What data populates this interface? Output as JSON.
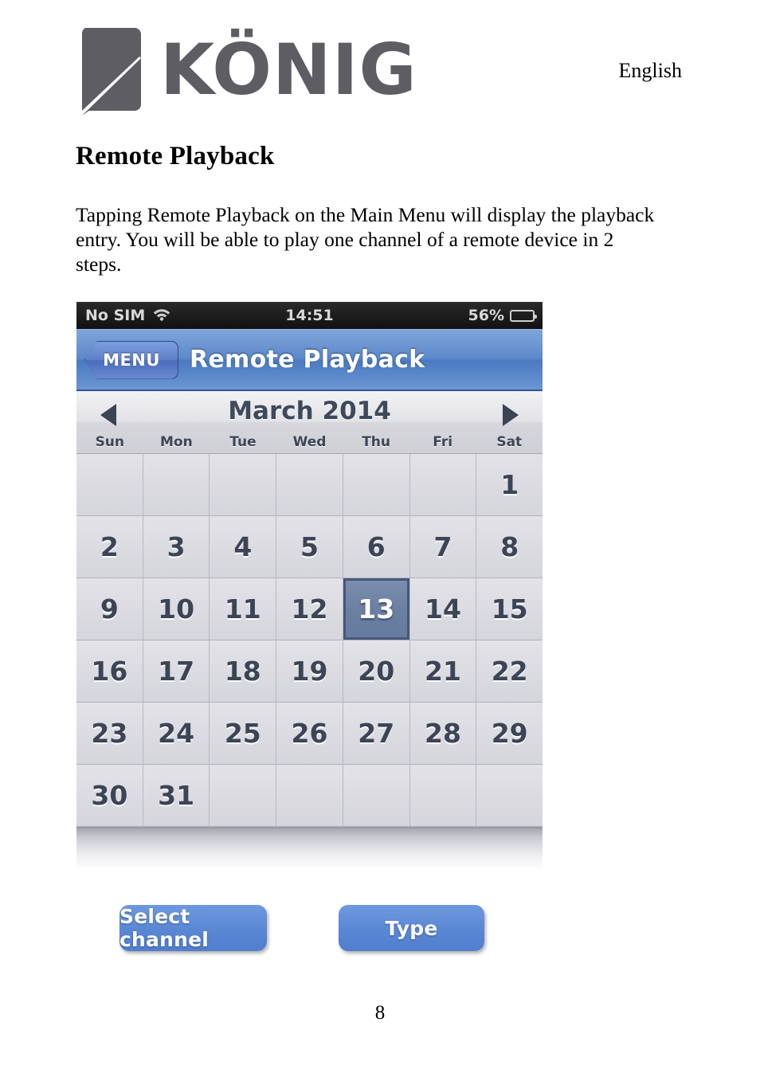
{
  "document": {
    "brand": "KÖNIG",
    "language": "English",
    "title": "Remote Playback",
    "paragraph": "Tapping Remote Playback on the Main Menu will display the playback entry. You will be able to play one channel of a remote device in 2 steps.",
    "page_number": "8"
  },
  "phone": {
    "statusbar": {
      "carrier": "No SIM",
      "wifi_icon": "wifi-icon",
      "time": "14:51",
      "battery_percent": "56%",
      "battery_level": 56
    },
    "navbar": {
      "back_label": "MENU",
      "title": "Remote Playback"
    },
    "calendar": {
      "month_label": "March 2014",
      "prev_icon": "triangle-left-icon",
      "next_icon": "triangle-right-icon",
      "weekdays": [
        "Sun",
        "Mon",
        "Tue",
        "Wed",
        "Thu",
        "Fri",
        "Sat"
      ],
      "selected_day": 13,
      "weeks": [
        [
          "",
          "",
          "",
          "",
          "",
          "",
          "1"
        ],
        [
          "2",
          "3",
          "4",
          "5",
          "6",
          "7",
          "8"
        ],
        [
          "9",
          "10",
          "11",
          "12",
          "13",
          "14",
          "15"
        ],
        [
          "16",
          "17",
          "18",
          "19",
          "20",
          "21",
          "22"
        ],
        [
          "23",
          "24",
          "25",
          "26",
          "27",
          "28",
          "29"
        ],
        [
          "30",
          "31",
          "",
          "",
          "",
          "",
          ""
        ]
      ]
    }
  },
  "actions": {
    "select_channel_label": "Select channel",
    "type_label": "Type"
  },
  "colors": {
    "navbar_blue": "#5d89ca",
    "button_blue": "#5a87d4",
    "selected_day_blue": "#6b80a3",
    "logo_gray": "#5d5d63",
    "statusbar_black": "#1c1c1c"
  }
}
